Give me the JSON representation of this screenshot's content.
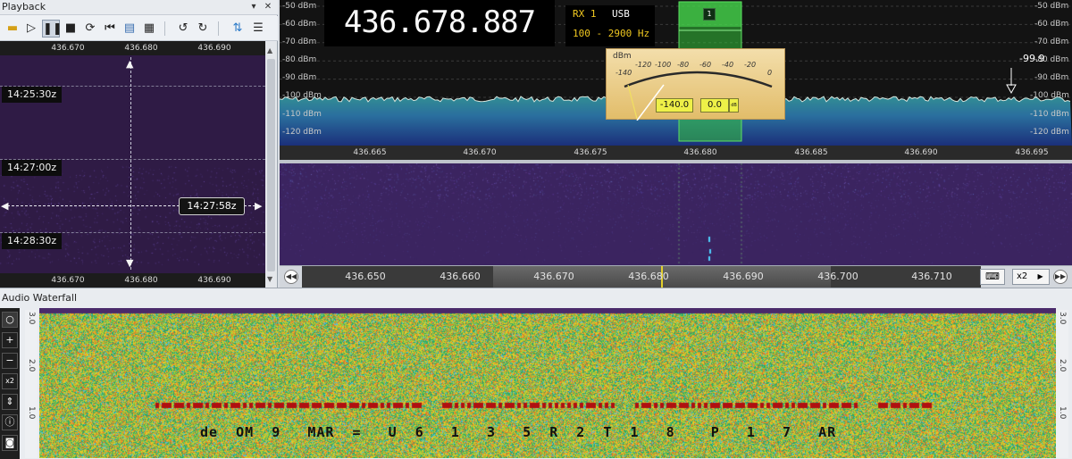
{
  "playback": {
    "title": "Playback",
    "window_icons": [
      "pin-icon",
      "close-icon"
    ],
    "toolbar": [
      "open-folder-icon",
      "play-icon",
      "pause-icon",
      "stop-icon",
      "loop-icon",
      "skip-back-icon",
      "print-icon",
      "calendar-icon",
      "undo-icon",
      "redo-icon",
      "refresh-icon",
      "menu-icon"
    ],
    "ruler_top": [
      "436.670",
      "436.680",
      "436.690"
    ],
    "ruler_bottom": [
      "436.670",
      "436.680",
      "436.690"
    ],
    "times": [
      "14:25:30z",
      "14:27:00z",
      "14:28:30z"
    ],
    "cursor_time": "14:27:58z"
  },
  "spectrum": {
    "frequency": "436.678.887",
    "rx": "RX 1",
    "mode": "USB",
    "bandwidth": "100 - 2900 Hz",
    "vfo_number": "1",
    "dbm_left": [
      "-50 dBm",
      "-60 dBm",
      "-70 dBm",
      "-80 dBm",
      "-90 dBm",
      "-100 dBm",
      "-110 dBm",
      "-120 dBm"
    ],
    "dbm_right": [
      "-50 dBm",
      "-60 dBm",
      "-70 dBm",
      "-80 dBm",
      "-90 dBm",
      "-100 dBm",
      "-110 dBm",
      "-120 dBm"
    ],
    "freq_ticks": [
      "436.665",
      "436.670",
      "436.675",
      "436.680",
      "436.685",
      "436.690",
      "436.695"
    ],
    "peak_marker": "-99.9",
    "colors": {
      "passband": "#35c23a",
      "trace": "#d8e8e0",
      "fill_top": "#3aa98a",
      "fill_bottom": "#1d3b8a"
    }
  },
  "smeter": {
    "unit": "dBm",
    "scale": [
      "-140",
      "-120",
      "-100",
      "-80",
      "-60",
      "-40",
      "-20",
      "0"
    ],
    "level_value": "-140.0",
    "offset_value": "0.0",
    "offset_unit": "dB"
  },
  "tuning": {
    "scale": [
      "436.650",
      "436.660",
      "436.670",
      "436.680",
      "436.690",
      "436.700",
      "436.710"
    ],
    "zoom": "x2"
  },
  "audio_waterfall": {
    "title": "Audio Waterfall",
    "tools": [
      "circle-icon",
      "plus-icon",
      "minus-icon",
      "x2",
      "updown-icon",
      "info-icon",
      "camera-icon"
    ],
    "scale_left": [
      "3.0",
      "2.0",
      "1.0"
    ],
    "scale_right": [
      "3.0",
      "2.0",
      "1.0"
    ],
    "decoded_text": "de  OM  9   MAR  =   U  6   1   3   5  R  2  T  1   8    P   1   7   AR"
  }
}
